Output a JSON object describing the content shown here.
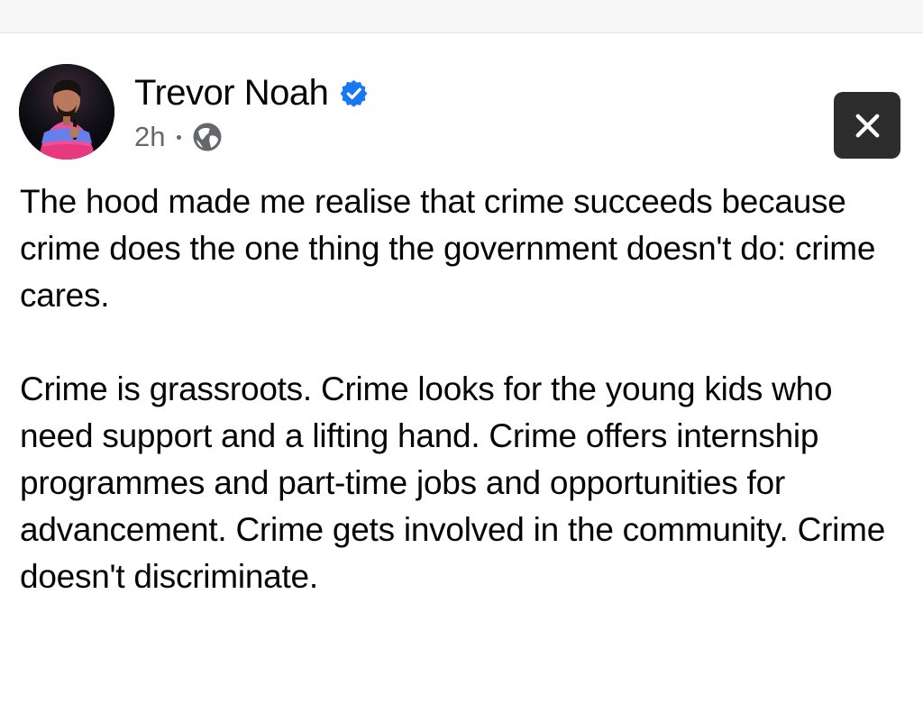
{
  "post": {
    "author": {
      "name": "Trevor Noah",
      "verified": true,
      "verified_icon": "verified-badge-icon",
      "avatar_icon": "profile-avatar"
    },
    "meta": {
      "timestamp": "2h",
      "separator_icon": "middle-dot-icon",
      "audience_icon": "globe-icon"
    },
    "close_icon": "close-icon",
    "paragraphs": [
      "The hood made me realise that crime succeeds because crime does the one thing the government doesn't do: crime cares.",
      "Crime is grassroots. Crime looks for the young kids who need support and a lifting hand. Crime offers internship programmes and part-time jobs and opportunities for advancement. Crime gets involved in the community. Crime doesn't discriminate."
    ]
  },
  "colors": {
    "text_primary": "#050505",
    "text_secondary": "#65676b",
    "verified_blue": "#1877f2",
    "close_button_bg": "#2d2d2d",
    "page_bg": "#ffffff"
  }
}
